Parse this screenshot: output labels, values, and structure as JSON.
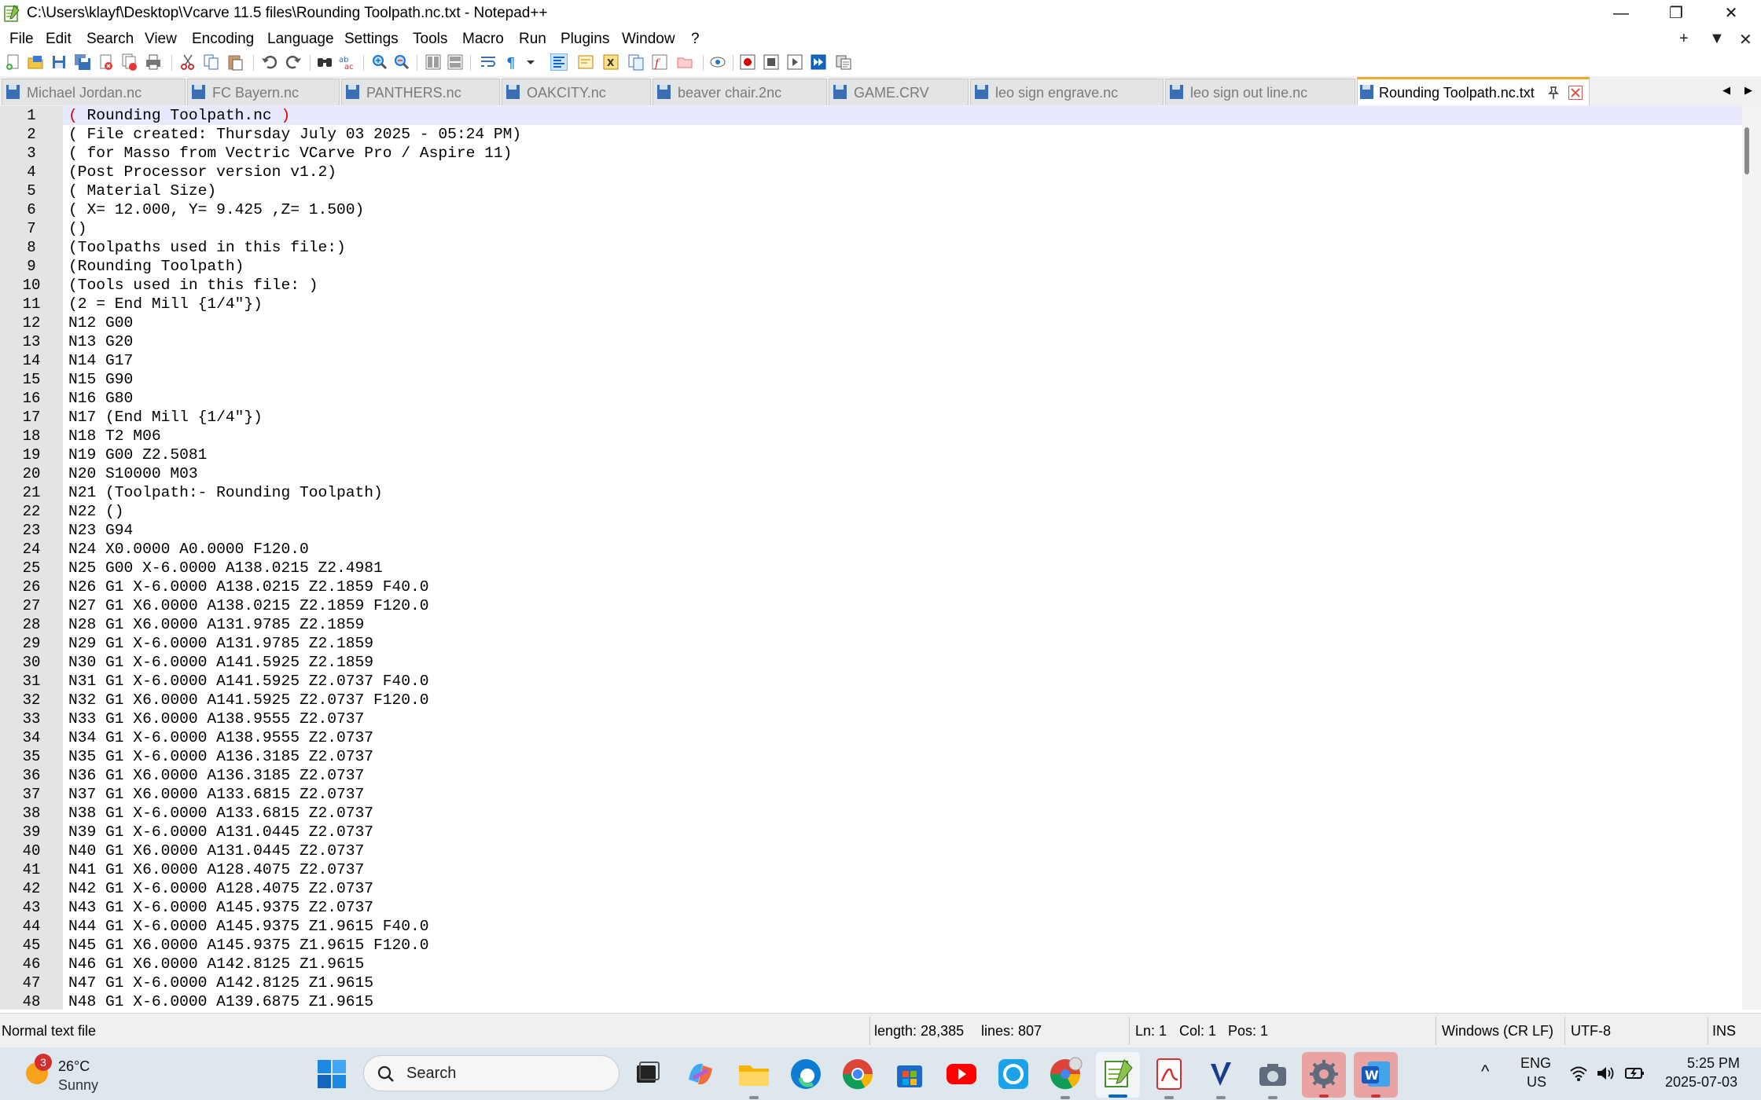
{
  "window": {
    "title": "C:\\Users\\klayf\\Desktop\\Vcarve 11.5 files\\Rounding Toolpath.nc.txt - Notepad++",
    "minimize": "—",
    "restore": "❐",
    "close": "✕"
  },
  "menu": {
    "items": [
      "File",
      "Edit",
      "Search",
      "View",
      "Encoding",
      "Language",
      "Settings",
      "Tools",
      "Macro",
      "Run",
      "Plugins",
      "Window",
      "?"
    ],
    "right": [
      "+",
      "▼",
      "✕"
    ]
  },
  "toolbar": {
    "icons": [
      "new-file-icon",
      "open-file-icon",
      "save-icon",
      "save-all-icon",
      "close-icon",
      "close-all-icon",
      "print-icon",
      "cut-icon",
      "copy-icon",
      "paste-icon",
      "undo-icon",
      "redo-icon",
      "find-icon",
      "replace-icon",
      "zoom-in-icon",
      "zoom-out-icon",
      "sync-vertical-icon",
      "sync-horizontal-icon",
      "word-wrap-icon",
      "show-all-chars-icon",
      "dropdown-icon",
      "indent-guide-icon",
      "user-language-icon",
      "document-map-icon",
      "document-list-icon",
      "function-list-icon",
      "folder-workspace-icon",
      "monitoring-icon",
      "record-macro-icon",
      "stop-record-icon",
      "play-macro-icon",
      "run-macro-multiple-icon",
      "save-macro-icon"
    ]
  },
  "tabs": [
    {
      "label": "Michael Jordan.nc",
      "active": false
    },
    {
      "label": "FC Bayern.nc",
      "active": false
    },
    {
      "label": "PANTHERS.nc",
      "active": false
    },
    {
      "label": "OAKCITY.nc",
      "active": false
    },
    {
      "label": "beaver chair.2nc",
      "active": false
    },
    {
      "label": "GAME.CRV",
      "active": false
    },
    {
      "label": "leo sign engrave.nc",
      "active": false
    },
    {
      "label": "leo sign out line.nc",
      "active": false
    },
    {
      "label": "Rounding Toolpath.nc.txt",
      "active": true
    }
  ],
  "tab_nav": {
    "prev": "◀",
    "next": "▶"
  },
  "editor": {
    "line_numbers": [
      "1",
      "2",
      "3",
      "4",
      "5",
      "6",
      "7",
      "8",
      "9",
      "10",
      "11",
      "12",
      "13",
      "14",
      "15",
      "16",
      "17",
      "18",
      "19",
      "20",
      "21",
      "22",
      "23",
      "24",
      "25",
      "26",
      "27",
      "28",
      "29",
      "30",
      "31",
      "32",
      "33",
      "34",
      "35",
      "36",
      "37",
      "38",
      "39",
      "40",
      "41",
      "42",
      "43",
      "44",
      "45",
      "46",
      "47",
      "48"
    ],
    "first_line": {
      "open": "(",
      "body": " Rounding Toolpath.nc ",
      "close": ")"
    },
    "lines": [
      "( File created: Thursday July 03 2025 - 05:24 PM)",
      "( for Masso from Vectric VCarve Pro / Aspire 11)",
      "(Post Processor version v1.2)",
      "( Material Size)",
      "( X= 12.000, Y= 9.425 ,Z= 1.500)",
      "()",
      "(Toolpaths used in this file:)",
      "(Rounding Toolpath)",
      "(Tools used in this file: )",
      "(2 = End Mill {1/4\"})",
      "N12 G00",
      "N13 G20",
      "N14 G17",
      "N15 G90",
      "N16 G80",
      "N17 (End Mill {1/4\"})",
      "N18 T2 M06",
      "N19 G00 Z2.5081",
      "N20 S10000 M03",
      "N21 (Toolpath:- Rounding Toolpath)",
      "N22 ()",
      "N23 G94",
      "N24 X0.0000 A0.0000 F120.0",
      "N25 G00 X-6.0000 A138.0215 Z2.4981",
      "N26 G1 X-6.0000 A138.0215 Z2.1859 F40.0",
      "N27 G1 X6.0000 A138.0215 Z2.1859 F120.0",
      "N28 G1 X6.0000 A131.9785 Z2.1859",
      "N29 G1 X-6.0000 A131.9785 Z2.1859",
      "N30 G1 X-6.0000 A141.5925 Z2.1859",
      "N31 G1 X-6.0000 A141.5925 Z2.0737 F40.0",
      "N32 G1 X6.0000 A141.5925 Z2.0737 F120.0",
      "N33 G1 X6.0000 A138.9555 Z2.0737",
      "N34 G1 X-6.0000 A138.9555 Z2.0737",
      "N35 G1 X-6.0000 A136.3185 Z2.0737",
      "N36 G1 X6.0000 A136.3185 Z2.0737",
      "N37 G1 X6.0000 A133.6815 Z2.0737",
      "N38 G1 X-6.0000 A133.6815 Z2.0737",
      "N39 G1 X-6.0000 A131.0445 Z2.0737",
      "N40 G1 X6.0000 A131.0445 Z2.0737",
      "N41 G1 X6.0000 A128.4075 Z2.0737",
      "N42 G1 X-6.0000 A128.4075 Z2.0737",
      "N43 G1 X-6.0000 A145.9375 Z2.0737",
      "N44 G1 X-6.0000 A145.9375 Z1.9615 F40.0",
      "N45 G1 X6.0000 A145.9375 Z1.9615 F120.0",
      "N46 G1 X6.0000 A142.8125 Z1.9615",
      "N47 G1 X-6.0000 A142.8125 Z1.9615",
      "N48 G1 X-6.0000 A139.6875 Z1.9615"
    ]
  },
  "status": {
    "file_type": "Normal text file",
    "length": "length: 28,385",
    "lines": "lines: 807",
    "ln": "Ln: 1",
    "col": "Col: 1",
    "pos": "Pos: 1",
    "eol": "Windows (CR LF)",
    "encoding": "UTF-8",
    "mode": "INS"
  },
  "taskbar": {
    "weather_badge": "3",
    "temperature": "26°C",
    "condition": "Sunny",
    "search_placeholder": "Search",
    "language_top": "ENG",
    "language_bottom": "US",
    "time": "5:25 PM",
    "date": "2025-07-03",
    "tray_chevron": "^"
  },
  "colors": {
    "brace_highlight": "#e00000",
    "active_tab_accent": "#f5a623",
    "current_line": "#e8e8ff",
    "gutter": "#e4e4e4"
  }
}
